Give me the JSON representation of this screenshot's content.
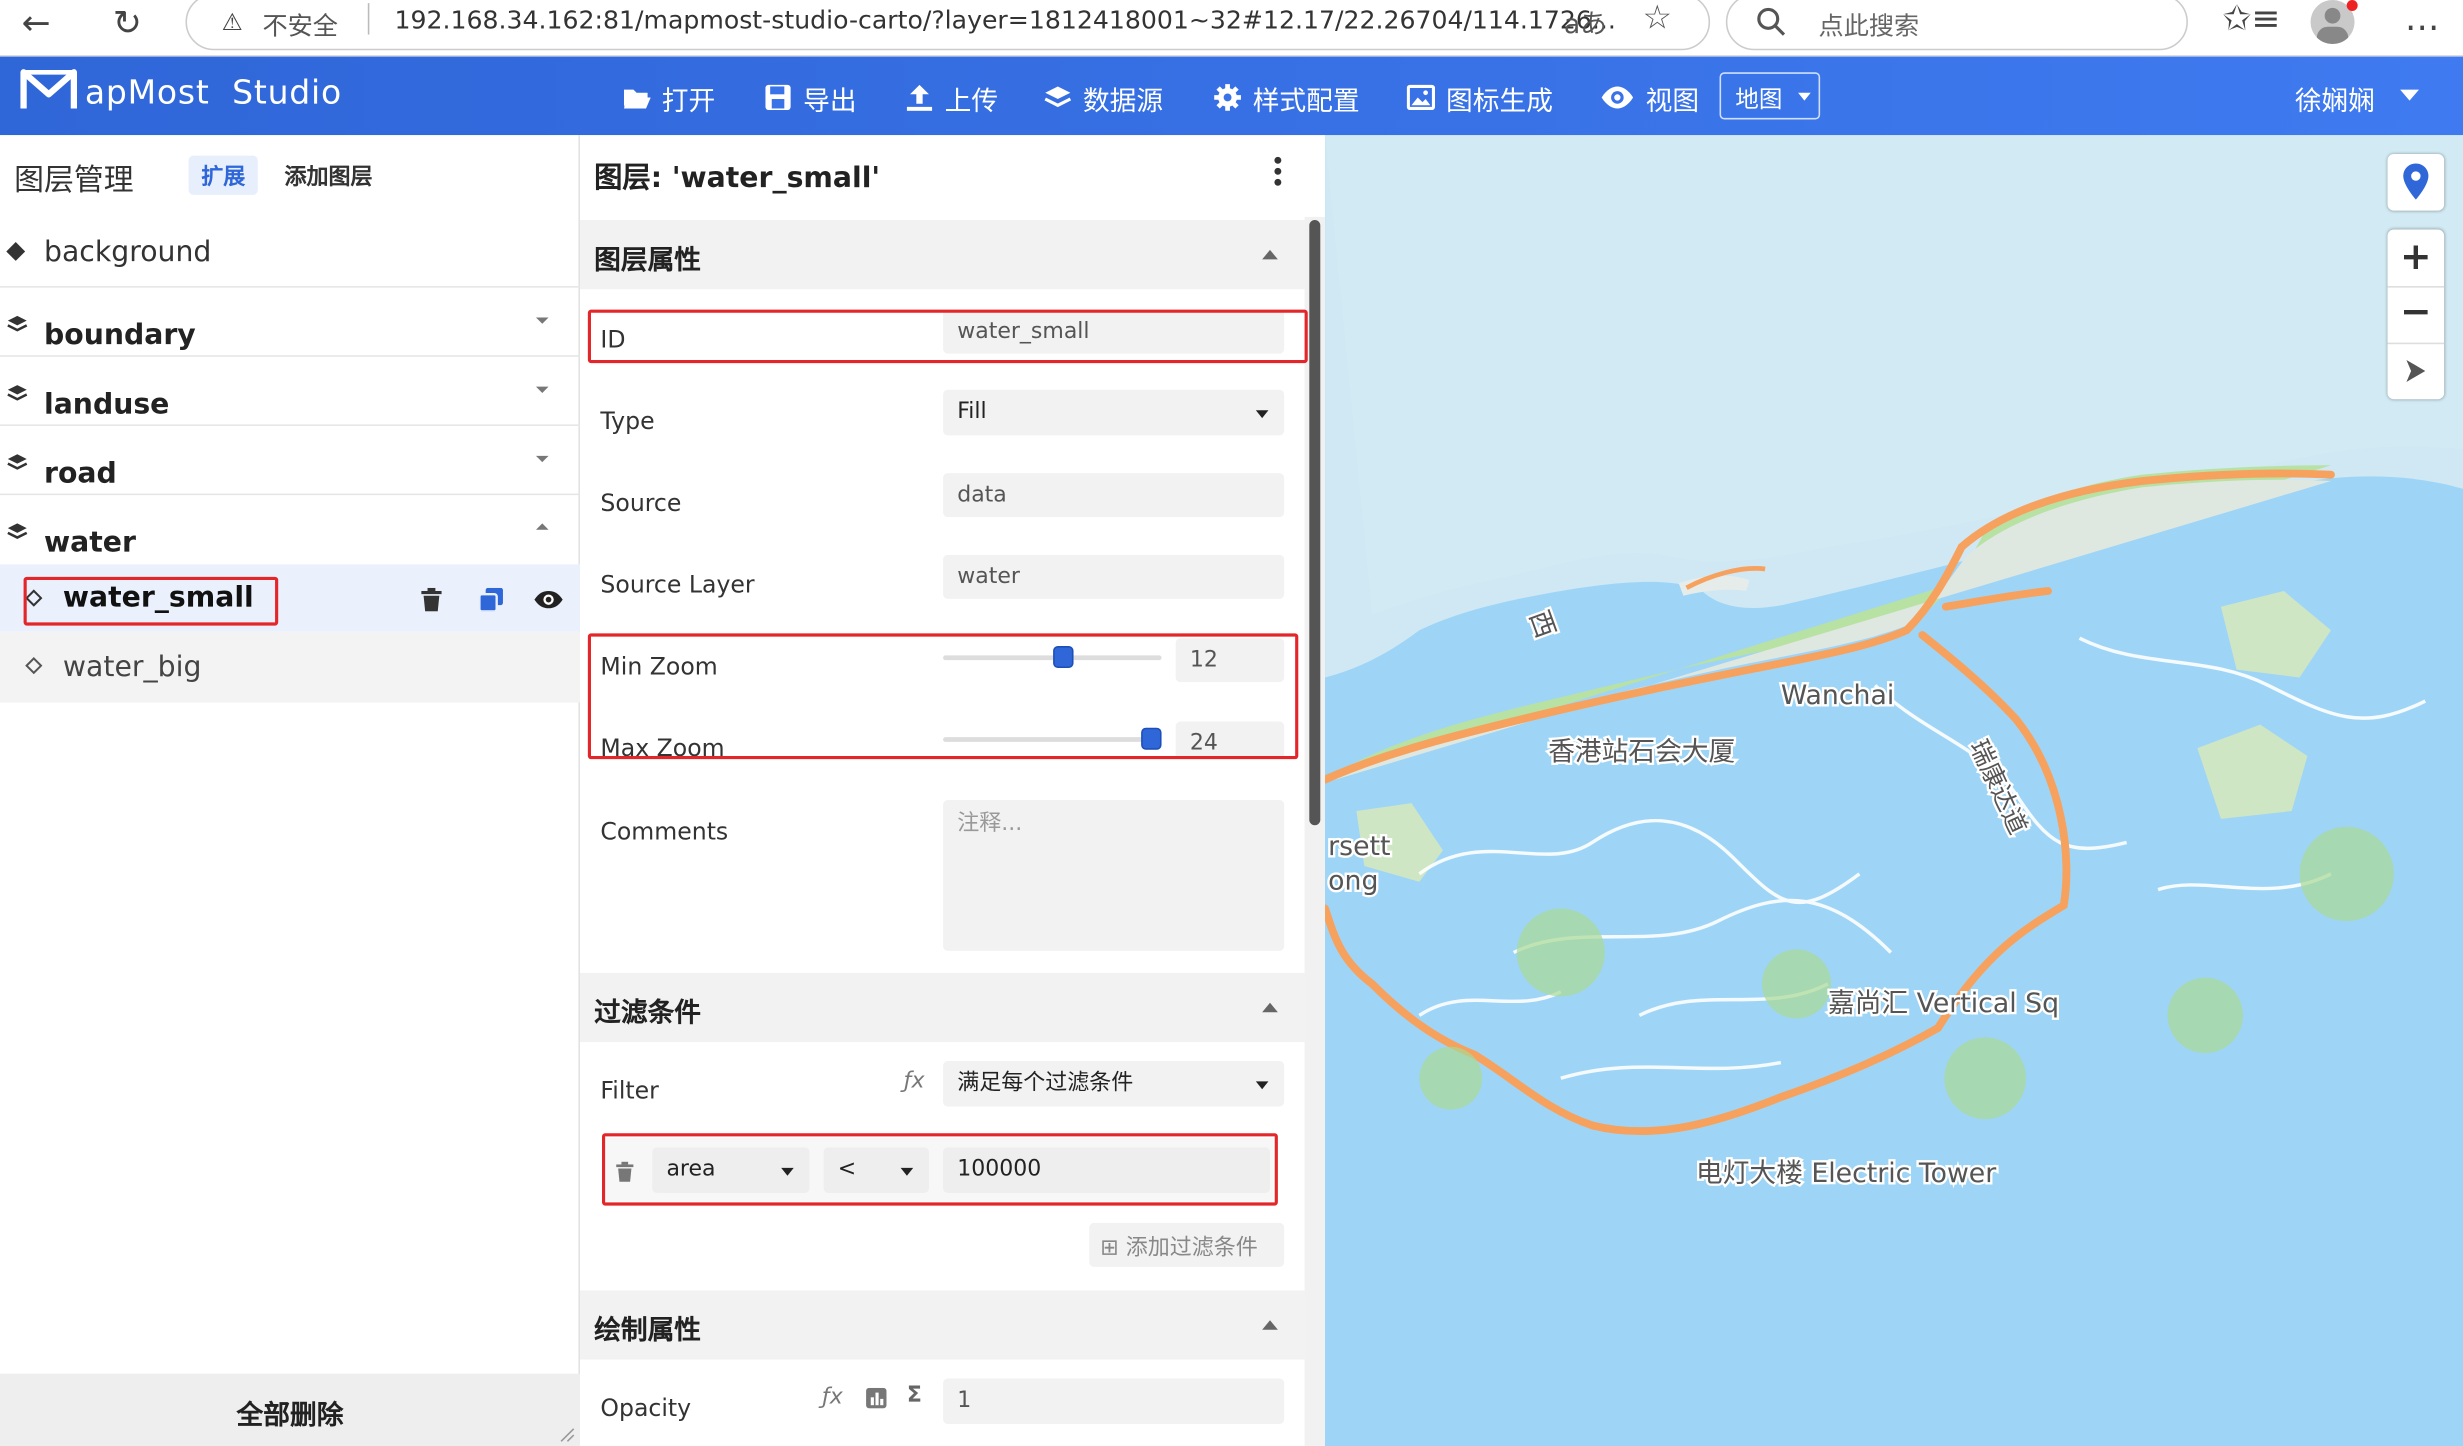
{
  "browser": {
    "back_label": "←",
    "reload_label": "↻",
    "security_text": "不安全",
    "url": "192.168.34.162:81/mapmost-studio-carto/?layer=1812418001~32#12.17/22.26704/114.1726...",
    "search_placeholder": "点此搜索"
  },
  "app": {
    "logo_rest": "apMost  Studio",
    "menu": [
      {
        "label": "打开",
        "icon": "folder-open-icon"
      },
      {
        "label": "导出",
        "icon": "save-icon"
      },
      {
        "label": "上传",
        "icon": "upload-icon"
      },
      {
        "label": "数据源",
        "icon": "layers-icon"
      },
      {
        "label": "样式配置",
        "icon": "gear-icon"
      },
      {
        "label": "图标生成",
        "icon": "image-icon"
      },
      {
        "label": "视图",
        "icon": "eye-icon"
      }
    ],
    "view_select": "地图",
    "user_name": "徐娴娴"
  },
  "layer_panel": {
    "title": "图层管理",
    "tab_expand": "扩展",
    "tab_add": "添加图层",
    "background": "background",
    "groups": [
      "boundary",
      "landuse",
      "road",
      "water"
    ],
    "water_children": [
      "water_small",
      "water_big"
    ],
    "delete_all": "全部删除"
  },
  "editor": {
    "title": "图层: 'water_small'",
    "sections": {
      "props": "图层属性",
      "filter": "过滤条件",
      "paint": "绘制属性"
    },
    "fields": {
      "id_label": "ID",
      "id_value": "water_small",
      "type_label": "Type",
      "type_value": "Fill",
      "source_label": "Source",
      "source_value": "data",
      "source_layer_label": "Source Layer",
      "source_layer_value": "water",
      "minzoom_label": "Min Zoom",
      "minzoom_value": "12",
      "maxzoom_label": "Max Zoom",
      "maxzoom_value": "24",
      "comments_label": "Comments",
      "comments_placeholder": "注释..."
    },
    "zoom_sliders": {
      "min": 12,
      "max": 24,
      "range_max": 24
    },
    "filter": {
      "label": "Filter",
      "mode": "满足每个过滤条件",
      "key": "area",
      "op": "<",
      "value": "100000",
      "add_label": "添加过滤条件"
    },
    "paint": {
      "opacity_label": "Opacity",
      "opacity_value": "1"
    }
  },
  "map": {
    "labels": [
      "西",
      "Wanchai",
      "香港站石会大厦",
      "rsett",
      "ong",
      "嘉尚汇 Vertical Sq",
      "电灯大楼 Electric Tower",
      "瑞康达道"
    ],
    "colors": {
      "water": "#9ed5f7",
      "land": "#b8e1a4",
      "urban": "#dfe7e1",
      "road": "#f6a25e"
    }
  }
}
